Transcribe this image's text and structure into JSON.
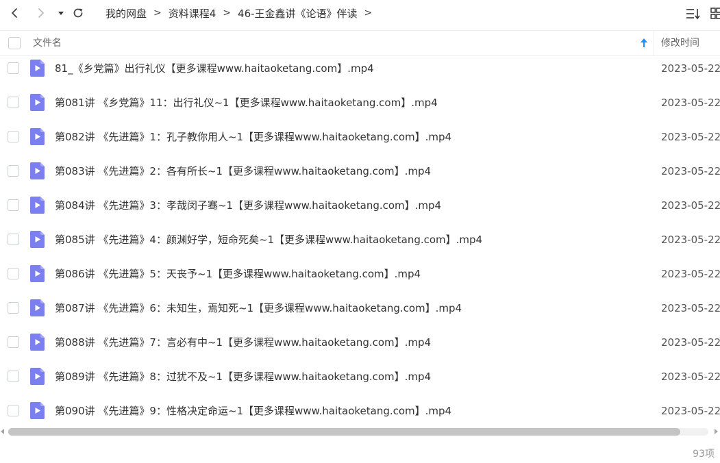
{
  "toolbar": {
    "back_icon": "chevron-left-icon",
    "forward_icon": "chevron-right-icon",
    "history_dropdown_icon": "caret-down-icon",
    "refresh_icon": "refresh-icon",
    "sort_icon": "sort-list-icon",
    "grid_view_icon": "grid-view-icon"
  },
  "breadcrumb": {
    "items": [
      {
        "label": "我的网盘"
      },
      {
        "label": "资料课程4"
      },
      {
        "label": "46-王金鑫讲《论语》伴读"
      }
    ],
    "separator": ">"
  },
  "columns": {
    "name_label": "文件名",
    "mtime_label": "修改时间",
    "sort_direction": "ascending",
    "sort_color": "#1e90ff"
  },
  "files": [
    {
      "name": "81_《乡党篇》出行礼仪【更多课程www.haitaoketang.com】.mp4",
      "modified": "2023-05-22"
    },
    {
      "name": "第081讲 《乡党篇》11：出行礼仪~1【更多课程www.haitaoketang.com】.mp4",
      "modified": "2023-05-22"
    },
    {
      "name": "第082讲 《先进篇》1：孔子教你用人~1【更多课程www.haitaoketang.com】.mp4",
      "modified": "2023-05-22"
    },
    {
      "name": "第083讲 《先进篇》2：各有所长~1【更多课程www.haitaoketang.com】.mp4",
      "modified": "2023-05-22"
    },
    {
      "name": "第084讲 《先进篇》3：孝哉闵子骞~1【更多课程www.haitaoketang.com】.mp4",
      "modified": "2023-05-22"
    },
    {
      "name": "第085讲 《先进篇》4：颜渊好学，短命死矣~1【更多课程www.haitaoketang.com】.mp4",
      "modified": "2023-05-22"
    },
    {
      "name": "第086讲 《先进篇》5：天丧予~1【更多课程www.haitaoketang.com】.mp4",
      "modified": "2023-05-22"
    },
    {
      "name": "第087讲 《先进篇》6：未知生，焉知死~1【更多课程www.haitaoketang.com】.mp4",
      "modified": "2023-05-22"
    },
    {
      "name": "第088讲 《先进篇》7：言必有中~1【更多课程www.haitaoketang.com】.mp4",
      "modified": "2023-05-22"
    },
    {
      "name": "第089讲 《先进篇》8：过犹不及~1【更多课程www.haitaoketang.com】.mp4",
      "modified": "2023-05-22"
    },
    {
      "name": "第090讲 《先进篇》9：性格决定命运~1【更多课程www.haitaoketang.com】.mp4",
      "modified": "2023-05-22"
    }
  ],
  "file_icon": "video-file-icon",
  "file_icon_color": "#7b7ff0",
  "scrollbar": {
    "horizontal_position": 0,
    "visible_fraction": 0.96
  },
  "status": {
    "item_count": "93项"
  }
}
